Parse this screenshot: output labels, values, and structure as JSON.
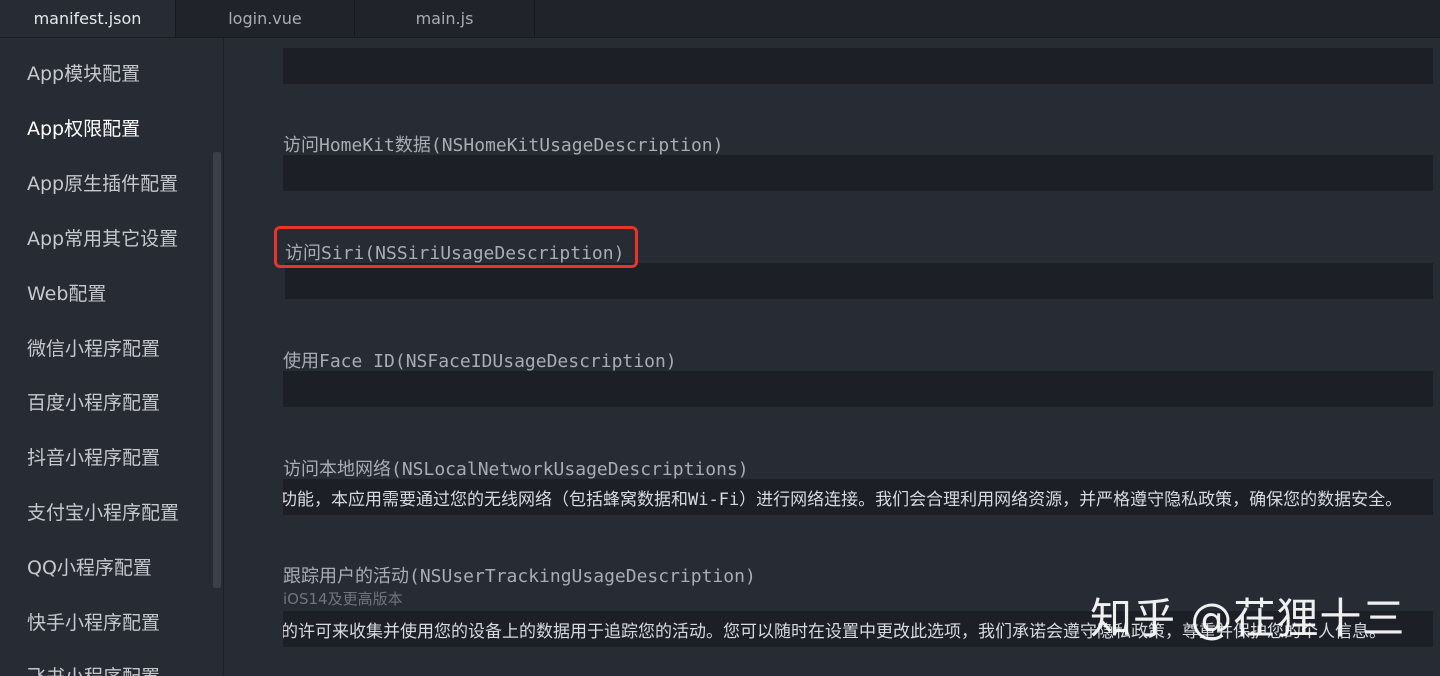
{
  "tabs": [
    {
      "label": "manifest.json",
      "active": true
    },
    {
      "label": "login.vue",
      "active": false
    },
    {
      "label": "main.js",
      "active": false
    }
  ],
  "sidebar": {
    "items": [
      {
        "label": "App模块配置"
      },
      {
        "label": "App权限配置",
        "active": true
      },
      {
        "label": "App原生插件配置"
      },
      {
        "label": "App常用其它设置"
      },
      {
        "label": "Web配置"
      },
      {
        "label": "微信小程序配置"
      },
      {
        "label": "百度小程序配置"
      },
      {
        "label": "抖音小程序配置"
      },
      {
        "label": "支付宝小程序配置"
      },
      {
        "label": "QQ小程序配置"
      },
      {
        "label": "快手小程序配置"
      },
      {
        "label": "飞书小程序配置"
      }
    ]
  },
  "fields": [
    {
      "label": "",
      "value": ""
    },
    {
      "label": "访问HomeKit数据(NSHomeKitUsageDescription)",
      "value": ""
    },
    {
      "label": "访问Siri(NSSiriUsageDescription)",
      "value": ""
    },
    {
      "label": "使用Face ID(NSFaceIDUsageDescription)",
      "value": ""
    },
    {
      "label": "访问本地网络(NSLocalNetworkUsageDescriptions)",
      "value": "为了提供更好的服务功能，本应用需要通过您的无线网络（包括蜂窝数据和Wi-Fi）进行网络连接。我们会合理利用网络资源，并严格遵守隐私政策，确保您的数据安全。"
    },
    {
      "label": "跟踪用户的活动(NSUserTrackingUsageDescription)",
      "sublabel": "iOS14及更高版本",
      "value": "请允许我们获取您的许可来收集并使用您的设备上的数据用于追踪您的活动。您可以随时在设置中更改此选项，我们承诺会遵守隐私政策，尊重并保护您的个人信息。"
    }
  ],
  "highlight_target": "访问Siri(NSSiriUsageDescription)",
  "watermark": "知乎 @茌狸十三",
  "colors": {
    "background": "#272b33",
    "input_background": "#1c1f25",
    "highlight_border": "#e8342a"
  }
}
